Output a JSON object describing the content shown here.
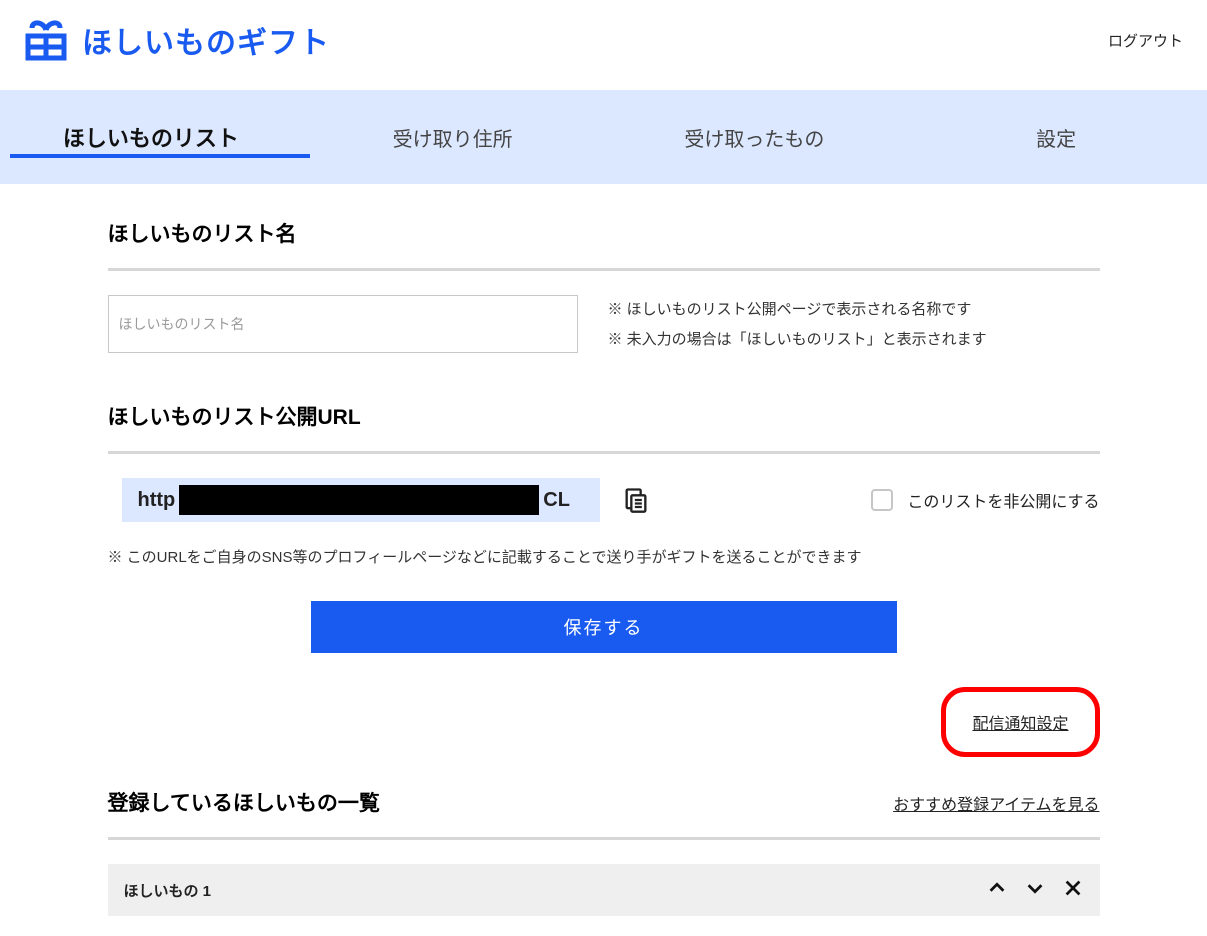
{
  "header": {
    "title": "ほしいものギフト",
    "logout": "ログアウト"
  },
  "tabs": {
    "items": [
      {
        "label": "ほしいものリスト",
        "active": true
      },
      {
        "label": "受け取り住所",
        "active": false
      },
      {
        "label": "受け取ったもの",
        "active": false
      },
      {
        "label": "設定",
        "active": false
      }
    ]
  },
  "section_name": {
    "title": "ほしいものリスト名",
    "placeholder": "ほしいものリスト名",
    "hint1": "※ ほしいものリスト公開ページで表示される名称です",
    "hint2": "※ 未入力の場合は「ほしいものリスト」と表示されます"
  },
  "section_url": {
    "title": "ほしいものリスト公開URL",
    "url_prefix": "http",
    "url_suffix": "CL",
    "private_label": "このリストを非公開にする",
    "note": "※ このURLをご自身のSNS等のプロフィールページなどに記載することで送り手がギフトを送ることができます"
  },
  "save_label": "保存する",
  "notification_link": "配信通知設定",
  "section_items": {
    "title": "登録しているほしいもの一覧",
    "recommend_link": "おすすめ登録アイテムを見る",
    "rows": [
      {
        "title": "ほしいもの 1"
      }
    ]
  }
}
